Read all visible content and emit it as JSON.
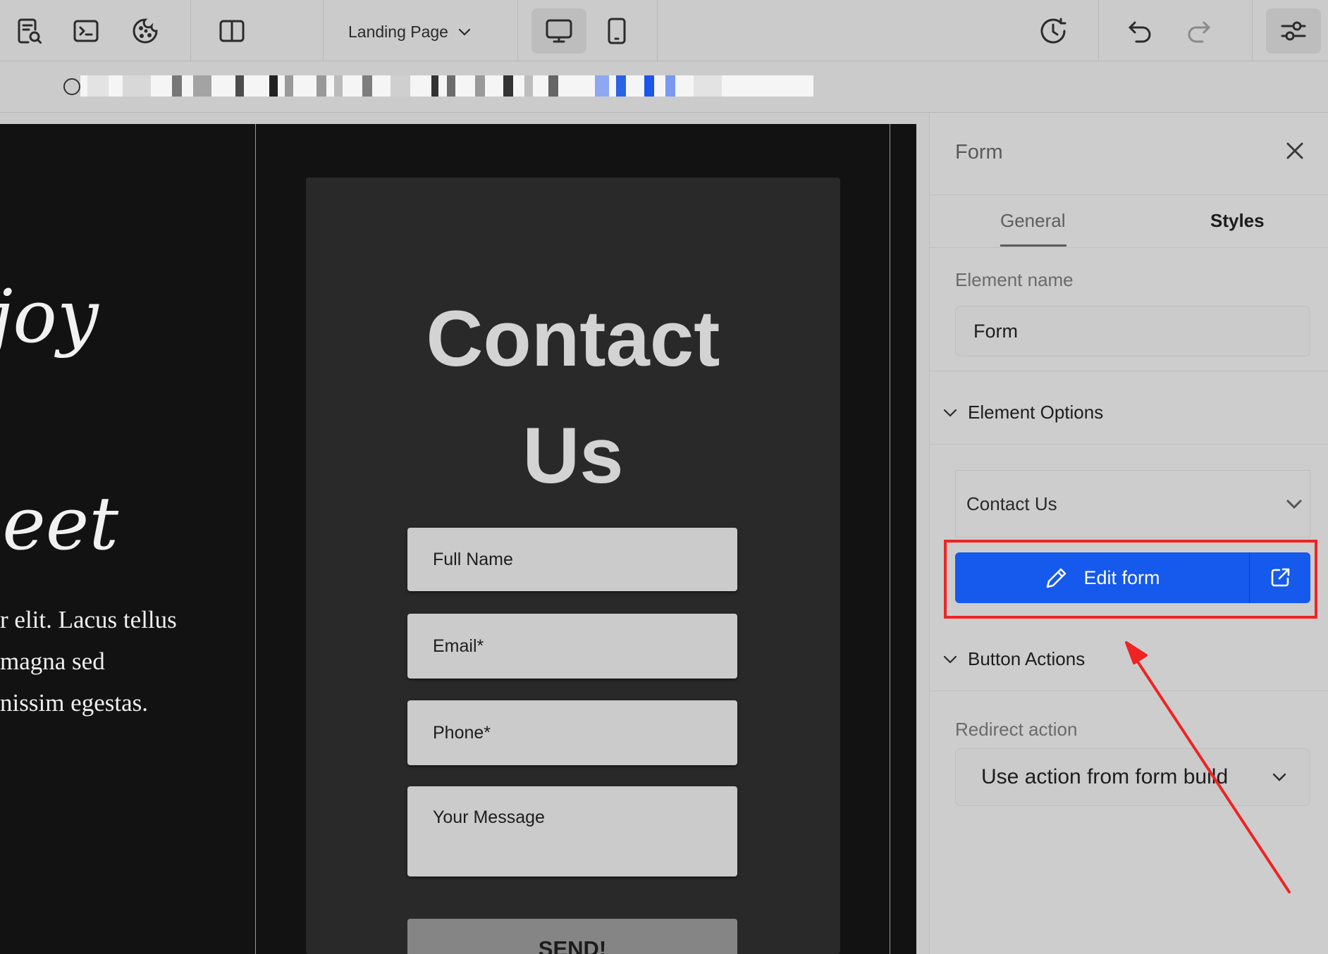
{
  "toolbar": {
    "page_selector": "Landing Page",
    "icons": [
      "page-search-icon",
      "terminal-icon",
      "cookie-icon",
      "split-layout-icon",
      "chevron-down-icon",
      "desktop-icon",
      "mobile-icon",
      "history-icon",
      "undo-icon",
      "redo-icon",
      "settings-sliders-icon"
    ]
  },
  "url_bar": {
    "url_obscured": true
  },
  "canvas": {
    "left_text_1": "joy",
    "left_text_2": "leet",
    "left_body_lines": [
      "r elit. Lacus tellus",
      "magna sed",
      "nissim egestas."
    ],
    "form": {
      "title_line_1": "Contact",
      "title_line_2": "Us",
      "fields": {
        "full_name": "Full Name",
        "email": "Email*",
        "phone": "Phone*",
        "message": "Your Message"
      },
      "submit_label": "SEND!"
    }
  },
  "panel": {
    "title": "Form",
    "tabs": {
      "general": "General",
      "styles": "Styles"
    },
    "element_name_label": "Element name",
    "element_name_value": "Form",
    "element_options_heading": "Element Options",
    "form_select_value": "Contact Us",
    "edit_form_label": "Edit form",
    "button_actions_heading": "Button Actions",
    "redirect_label": "Redirect action",
    "redirect_value": "Use action from form build"
  },
  "colors": {
    "accent_blue": "#1559ed",
    "annotation_red": "#ee2424",
    "canvas_bg": "#121212",
    "card_bg": "#292929"
  }
}
